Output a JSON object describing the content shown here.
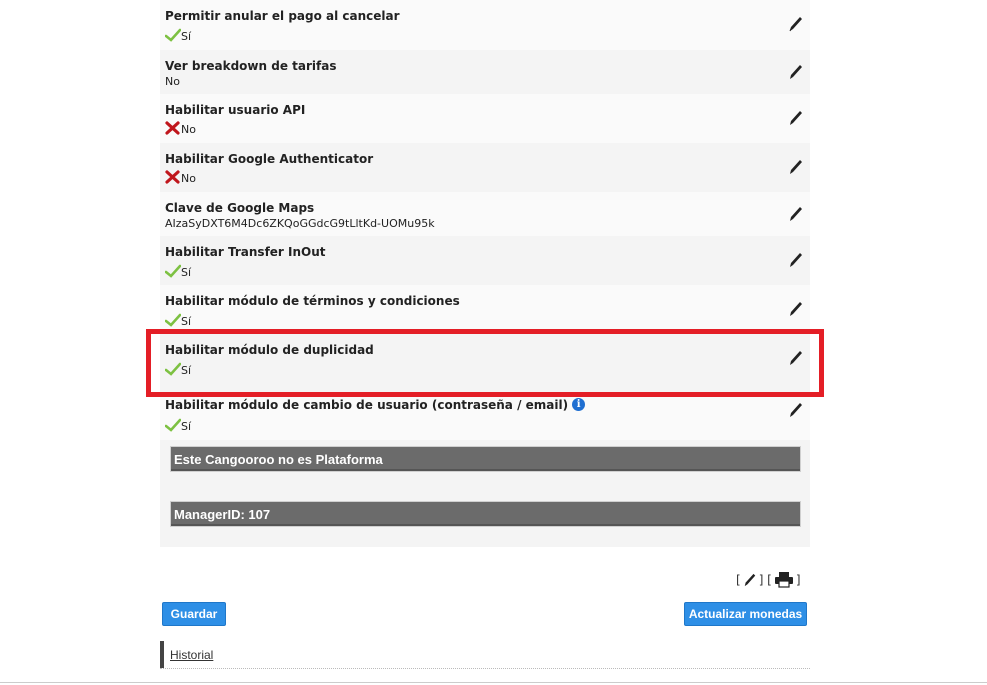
{
  "settings": [
    {
      "label": "Permitir anular el pago al cancelar",
      "value": "Sí",
      "status": "check"
    },
    {
      "label": "Ver breakdown de tarifas",
      "value": "No",
      "status": "none"
    },
    {
      "label": "Habilitar usuario API",
      "value": "No",
      "status": "cross"
    },
    {
      "label": "Habilitar Google Authenticator",
      "value": "No",
      "status": "cross"
    },
    {
      "label": "Clave de Google Maps",
      "value": "AIzaSyDXT6M4Dc6ZKQoGGdcG9tLltKd-UOMu95k",
      "status": "none"
    },
    {
      "label": "Habilitar Transfer InOut",
      "value": "Sí",
      "status": "check"
    },
    {
      "label": "Habilitar módulo de términos y condiciones",
      "value": "Sí",
      "status": "check"
    },
    {
      "label": "Habilitar módulo de duplicidad",
      "value": "Sí",
      "status": "check"
    },
    {
      "label": "Habilitar módulo de cambio de usuario (contraseña / email)",
      "value": "Sí",
      "status": "check"
    }
  ],
  "info_bars": {
    "platform": "Este Cangooroo no es Plataforma",
    "manager": "ManagerID: 107"
  },
  "tools": {
    "open": "[",
    "mid": "] [",
    "close": "]"
  },
  "buttons": {
    "save": "Guardar",
    "update_currencies": "Actualizar monedas"
  },
  "history_link": "Historial",
  "colors": {
    "accent": "#2e8fe6",
    "highlight": "#e41e26",
    "check": "#7dc142",
    "cross": "#c0161c",
    "bar": "#6b6b6b"
  }
}
